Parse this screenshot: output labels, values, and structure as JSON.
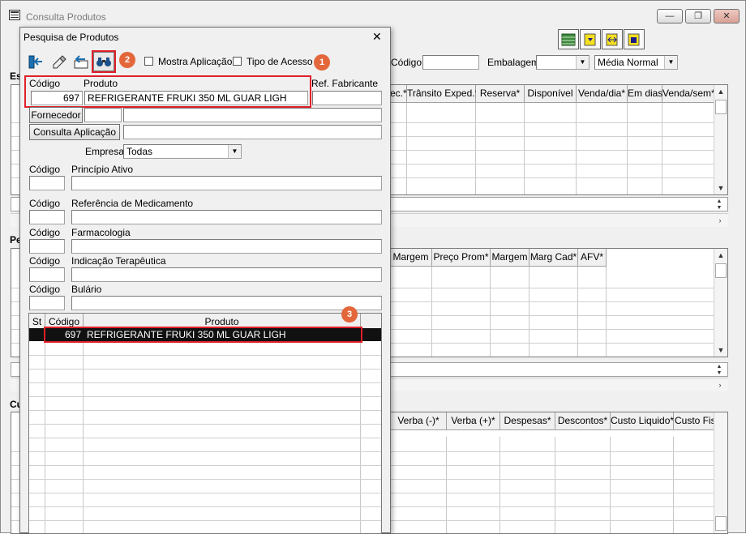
{
  "main_window": {
    "title": "Consulta Produtos",
    "minimize_glyph": "—",
    "restore_glyph": "❐",
    "close_glyph": "✕",
    "filters": {
      "codigo_label": "Código",
      "embalagem_label": "Embalagem",
      "media_value": "Média Normal"
    },
    "grid1_headers": [
      "ec.*",
      "Trânsito Exped.*",
      "Reserva*",
      "Disponível",
      "Venda/dia*",
      "Em dias",
      "Venda/sem*"
    ],
    "grid2_headers": [
      "Margem",
      "Preço Prom*",
      "Margem",
      "Marg Cad*",
      "AFV*"
    ],
    "grid3_headers": [
      "Verba (-)*",
      "Verba (+)*",
      "Despesas*",
      "Descontos*",
      "Custo Liquido*",
      "Custo Fiscal"
    ],
    "left_partial_labels": {
      "es": "Es",
      "pe": "Pe",
      "cu": "Cu",
      "s1": "s",
      "s2": "s",
      "s3": "s"
    }
  },
  "dialog": {
    "title": "Pesquisa de Produtos",
    "close_glyph": "✕",
    "toolbar": {
      "mostra_aplicacao_label": "Mostra Aplicação",
      "mostra_aplicacao_checked": false,
      "tipo_acesso_label": "Tipo de Acesso",
      "tipo_acesso_checked": false
    },
    "codigo_label": "Código",
    "produto_label": "Produto",
    "ref_fabricante_label": "Ref. Fabricante",
    "codigo_value": "697",
    "produto_value": "REFRIGERANTE FRUKI 350 ML GUAR LIGH",
    "fornecedor_button": "Fornecedor",
    "consulta_aplicacao_button": "Consulta Aplicação",
    "empresa_label": "Empresa",
    "empresa_value": "Todas",
    "sections": [
      {
        "codigo_label": "Código",
        "label": "Princípio Ativo"
      },
      {
        "codigo_label": "Código",
        "label": "Referência de Medicamento"
      },
      {
        "codigo_label": "Código",
        "label": "Farmacologia"
      },
      {
        "codigo_label": "Código",
        "label": "Indicação Terapêutica"
      },
      {
        "codigo_label": "Código",
        "label": "Bulário"
      }
    ],
    "results": {
      "headers": [
        "St",
        "Código",
        "Produto"
      ],
      "rows": [
        {
          "st": "",
          "codigo": "697",
          "produto": "REFRIGERANTE FRUKI 350 ML GUAR LIGH"
        }
      ]
    }
  },
  "annotations": {
    "badge1": "1",
    "badge2": "2",
    "badge3": "3"
  },
  "colors": {
    "highlight": "#e0202a",
    "badge": "#e3673b",
    "selected_row": "#111111"
  }
}
